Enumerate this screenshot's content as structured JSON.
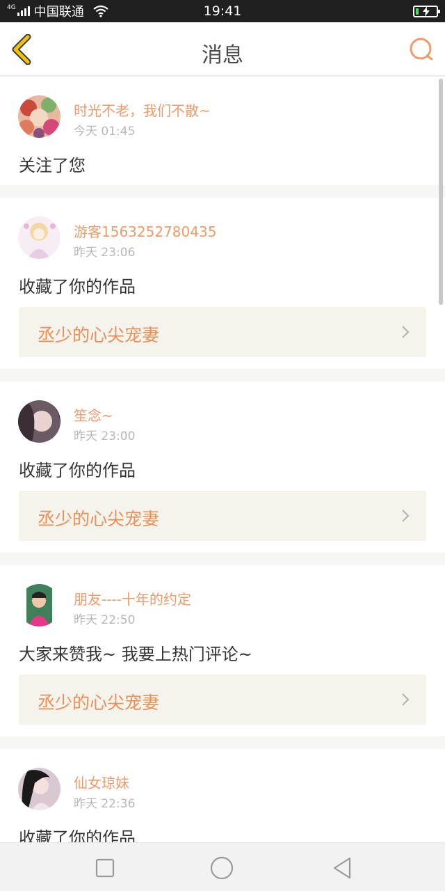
{
  "status_bar": {
    "network_type": "4G",
    "carrier": "中国联通",
    "time": "19:41",
    "battery_level": 0.15
  },
  "nav": {
    "title": "消息",
    "back_icon": "chevron-left-icon",
    "search_icon": "search-icon"
  },
  "colors": {
    "accent": "#ee9b6b",
    "link_bg": "#f4f3ec",
    "back_icon": "#f2c400"
  },
  "messages": [
    {
      "username": "时光不老，我们不散~",
      "time": "今天 01:45",
      "text": "关注了您"
    },
    {
      "username": "游客1563252780435",
      "time": "昨天 23:06",
      "text": "收藏了你的作品",
      "work": "丞少的心尖宠妻"
    },
    {
      "username": "笙念~",
      "time": "昨天 23:00",
      "text": "收藏了你的作品",
      "work": "丞少的心尖宠妻"
    },
    {
      "username": "朋友----十年的约定",
      "time": "昨天 22:50",
      "text": "大家来赞我~ 我要上热门评论~",
      "work": "丞少的心尖宠妻"
    },
    {
      "username": "仙女琼妹",
      "time": "昨天 22:36",
      "text": "收藏了你的作品"
    }
  ],
  "system_nav": {
    "recents_icon": "square-icon",
    "home_icon": "circle-icon",
    "back_icon": "triangle-back-icon"
  }
}
